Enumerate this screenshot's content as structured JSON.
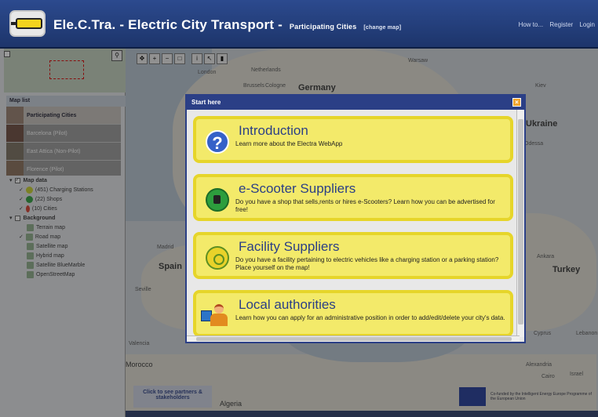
{
  "header": {
    "title": "Ele.C.Tra. - Electric City Transport -",
    "subtitle": "Participating Cities",
    "change_map": "[change map]",
    "nav": [
      "How to...",
      "Register",
      "Login"
    ]
  },
  "sidebar": {
    "map_list_title": "Map list",
    "map_list": [
      {
        "label": "Participating Cities"
      },
      {
        "label": "Barcelona (Pilot)"
      },
      {
        "label": "East Attica (Non-Pilot)"
      },
      {
        "label": "Florence (Pilot)"
      }
    ],
    "map_data_title": "Map data",
    "map_data": [
      "(451) Charging Stations",
      "(22) Shops",
      "(10) Cities"
    ],
    "background_title": "Background",
    "background": [
      "Terrain map",
      "Road map",
      "Satellite map",
      "Hybrid map",
      "Satellite BlueMarble",
      "OpenStreetMap"
    ]
  },
  "map": {
    "labels": [
      "London",
      "Netherlands",
      "Brussels",
      "Cologne",
      "Germany",
      "Warsaw",
      "Kiev",
      "Ukraine",
      "Odessa",
      "Madrid",
      "Spain",
      "Ankara",
      "Turkey",
      "Morocco",
      "Algeria",
      "Cyprus",
      "Lebanon",
      "Alexandria",
      "Cairo",
      "Israel",
      "Seville",
      "Valencia"
    ]
  },
  "footer": {
    "partners": "Click to see partners & stakeholders",
    "eu_text": "Co-funded by the Intelligent Energy Europe Programme of the European Union"
  },
  "dialog": {
    "title": "Start here",
    "close": "×",
    "cards": [
      {
        "heading": "Introduction",
        "desc": "Learn more about the Electra WebApp"
      },
      {
        "heading": "e-Scooter Suppliers",
        "desc": "Do you have a shop that sells,rents or hires e-Scooters? Learn how you can be advertised for free!"
      },
      {
        "heading": "Facility Suppliers",
        "desc": "Do you have a facility pertaining to electric vehicles like a charging station or a parking station? Place yourself on the map!"
      },
      {
        "heading": "Local authorities",
        "desc": "Learn how you can apply for an administrative position in order to add/edit/delete your city's data."
      }
    ]
  },
  "icons": {
    "introduction": "question-icon",
    "escooter": "scooter-pin-icon",
    "facility": "charging-pin-icon",
    "authorities": "admin-person-icon"
  },
  "colors": {
    "header": "#1d356b",
    "card": "#f3ea6a",
    "card_border": "#e6d52a",
    "heading": "#2b3f86"
  }
}
